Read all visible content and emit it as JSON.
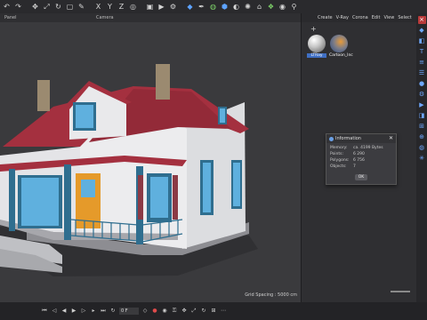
{
  "toolbar": {
    "icons": [
      "undo-icon",
      "redo-icon",
      "move-icon",
      "scale-icon",
      "rotate-icon",
      "select-icon",
      "brush-icon",
      "axis-x",
      "axis-y",
      "axis-z",
      "locate-icon",
      "render-region-icon",
      "render-view-icon",
      "render-settings-icon",
      "cube-icon",
      "spline-icon",
      "nurbs-icon",
      "deformer-icon",
      "field-icon",
      "light-icon",
      "camera-icon",
      "python-icon",
      "globe-icon",
      "snap-icon"
    ],
    "axis_x": "X",
    "axis_y": "Y",
    "axis_z": "Z"
  },
  "viewport": {
    "panel_label": "Panel",
    "camera_label": "Camera",
    "grid_spacing": "Grid Spacing : 5000 cm"
  },
  "material_manager": {
    "menu": [
      "Create",
      "V-Ray",
      "Corona",
      "Edit",
      "View",
      "Select"
    ],
    "materials": [
      {
        "name": "LTRay",
        "selected": true
      },
      {
        "name": "Cartoon_Inc",
        "selected": false
      }
    ]
  },
  "info_dialog": {
    "title": "Information",
    "rows": [
      {
        "key": "Memory:",
        "value": "ca. 4199 Bytes"
      },
      {
        "key": "Points:",
        "value": "6 290"
      },
      {
        "key": "Polygons:",
        "value": "6 756"
      },
      {
        "key": "Objects:",
        "value": "7"
      }
    ],
    "ok_label": "OK"
  },
  "timeline": {
    "current_frame": "0 F"
  },
  "colors": {
    "roof": "#a4303f",
    "wall": "#e9e9eb",
    "window_frame": "#2f6e8f",
    "door": "#e59a2a",
    "accent_blue": "#3f6fc4"
  }
}
